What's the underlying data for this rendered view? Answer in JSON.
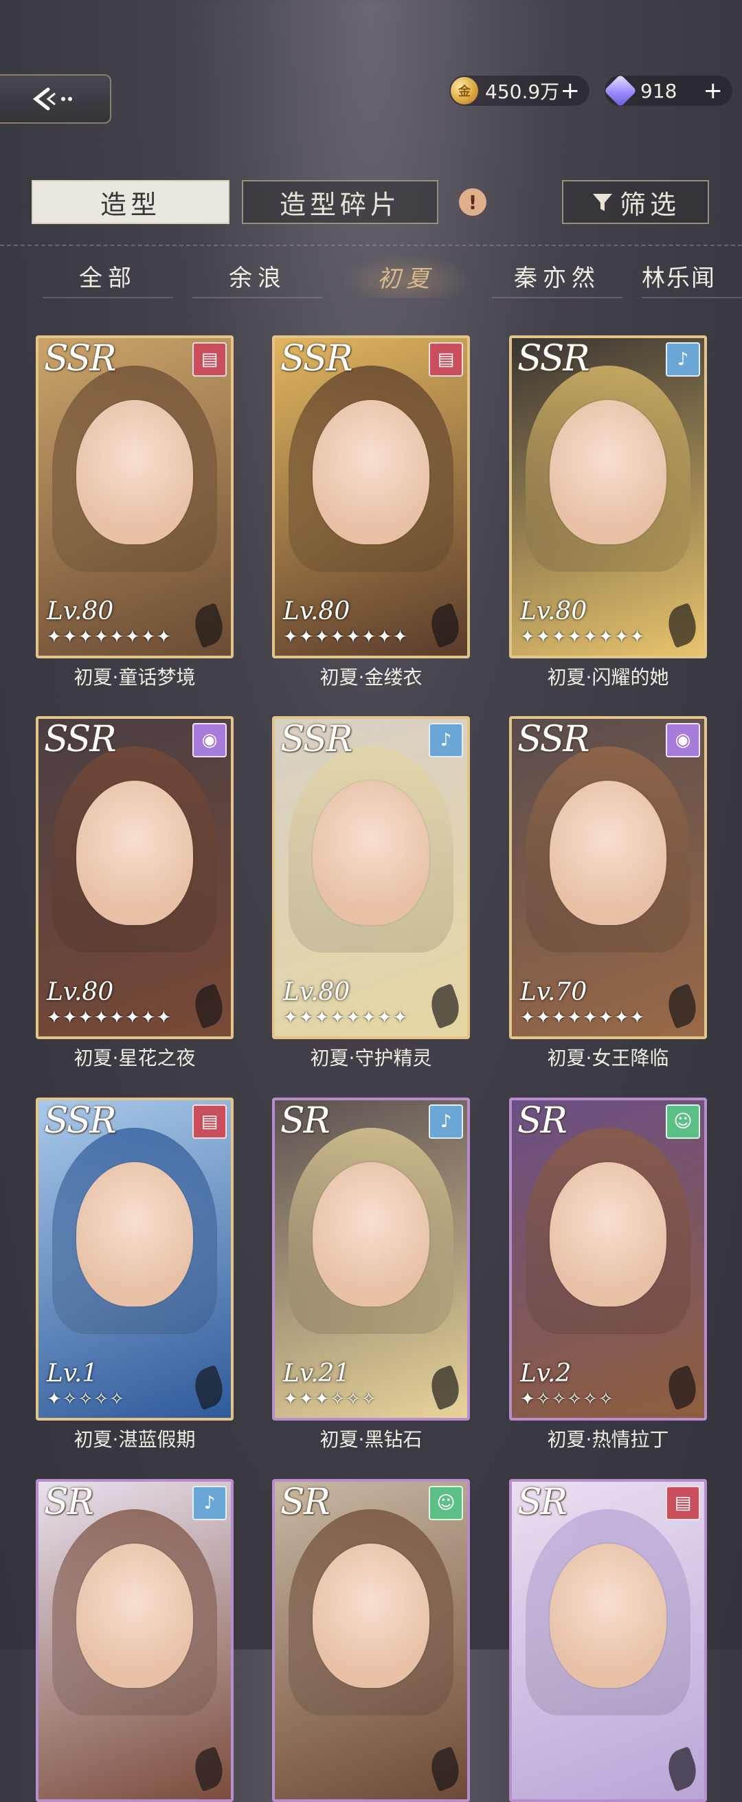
{
  "header": {
    "gold": "450.9万",
    "gems": "918",
    "plus": "+"
  },
  "tabs": {
    "outfit": "造型",
    "fragments": "造型碎片",
    "alert": "!",
    "filter": "筛选"
  },
  "characters": [
    "全部",
    "余浪",
    "初夏",
    "秦亦然",
    "林乐闻"
  ],
  "active_character": "初夏",
  "cards": [
    {
      "rarity": "SSR",
      "type": "film",
      "level": "Lv.80",
      "stars": "✦✦✦✦✦✦✦✦",
      "name": "初夏·童话梦境"
    },
    {
      "rarity": "SSR",
      "type": "film",
      "level": "Lv.80",
      "stars": "✦✦✦✦✦✦✦✦",
      "name": "初夏·金缕衣"
    },
    {
      "rarity": "SSR",
      "type": "mic",
      "level": "Lv.80",
      "stars": "✦✦✦✦✦✦✦✦",
      "name": "初夏·闪耀的她"
    },
    {
      "rarity": "SSR",
      "type": "disc",
      "level": "Lv.80",
      "stars": "✦✦✦✦✦✦✦✦",
      "name": "初夏·星花之夜"
    },
    {
      "rarity": "SSR",
      "type": "mic",
      "level": "Lv.80",
      "stars": "✦✦✦✦✦✦✦✦",
      "name": "初夏·守护精灵"
    },
    {
      "rarity": "SSR",
      "type": "disc",
      "level": "Lv.70",
      "stars": "✦✦✦✦✦✦✦✦",
      "name": "初夏·女王降临"
    },
    {
      "rarity": "SSR",
      "type": "film",
      "level": "Lv.1",
      "stars": "✦✧✧✧✧",
      "name": "初夏·湛蓝假期"
    },
    {
      "rarity": "SR",
      "type": "mic",
      "level": "Lv.21",
      "stars": "✦✦✦✧✧✧",
      "name": "初夏·黑钻石"
    },
    {
      "rarity": "SR",
      "type": "smile",
      "level": "Lv.2",
      "stars": "✦✧✧✧✧✧",
      "name": "初夏·热情拉丁"
    },
    {
      "rarity": "SR",
      "type": "mic",
      "level": "",
      "stars": "",
      "name": ""
    },
    {
      "rarity": "SR",
      "type": "smile",
      "level": "",
      "stars": "",
      "name": ""
    },
    {
      "rarity": "SR",
      "type": "film",
      "level": "",
      "stars": "",
      "name": ""
    }
  ]
}
